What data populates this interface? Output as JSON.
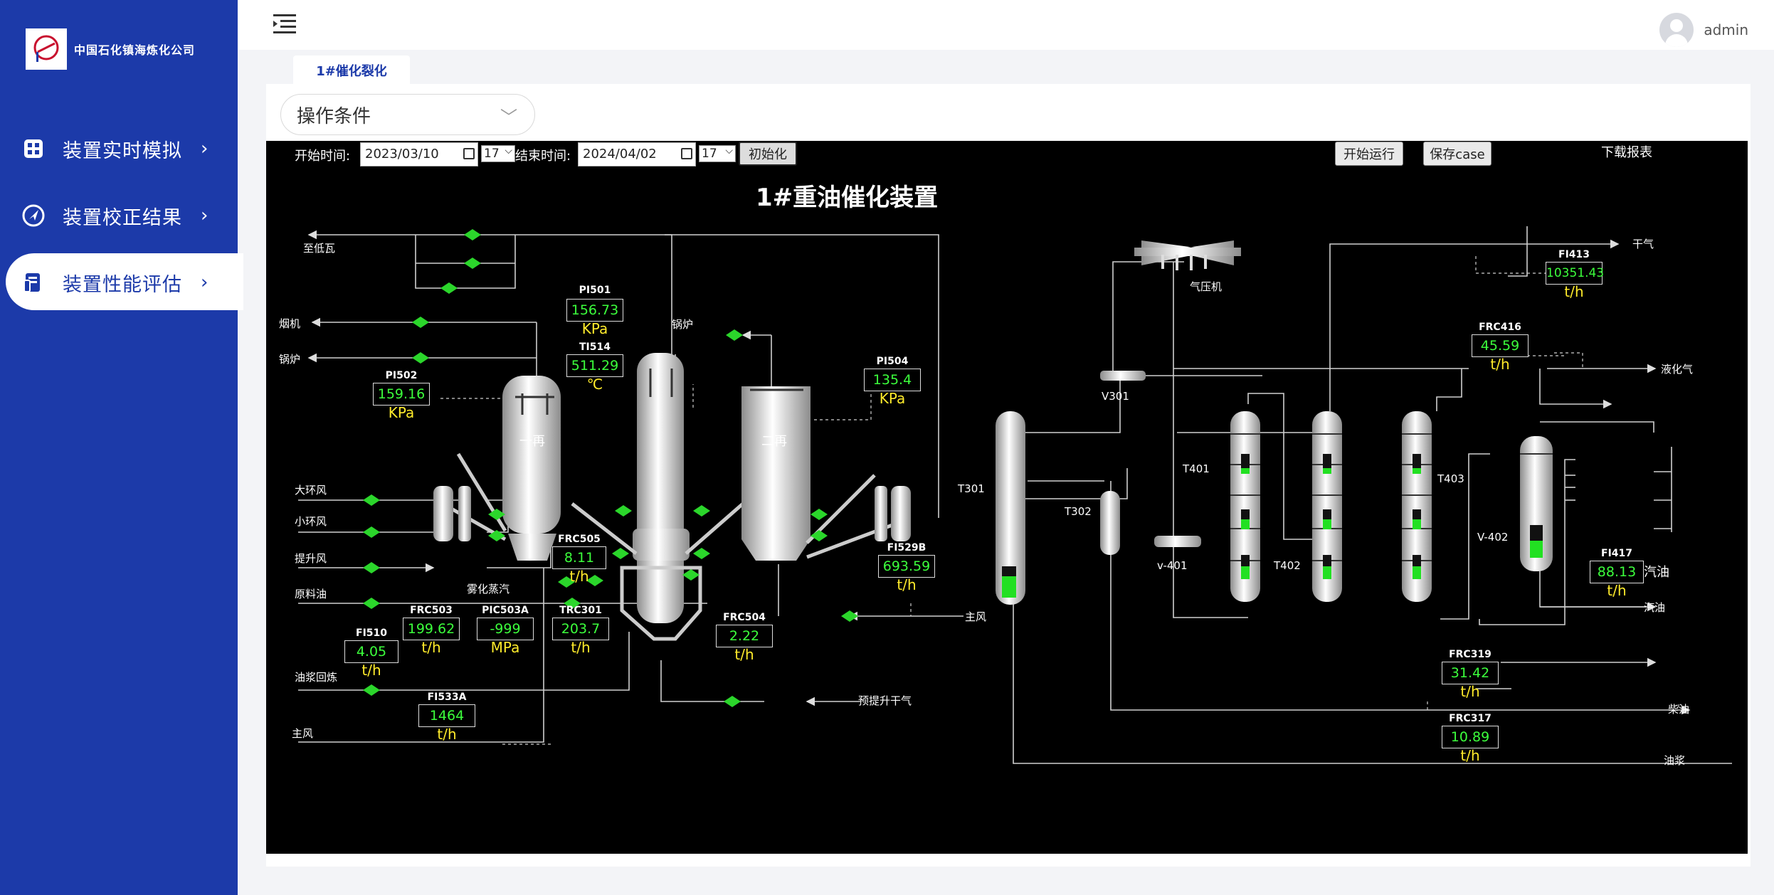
{
  "sidebar": {
    "company": "中国石化镇海炼化公司",
    "logo_text": "Sinopec",
    "items": [
      {
        "label": "装置实时模拟"
      },
      {
        "label": "装置校正结果"
      },
      {
        "label": "装置性能评估"
      }
    ]
  },
  "header": {
    "username": "admin"
  },
  "tab": {
    "label": "1#催化裂化"
  },
  "select": {
    "value": "操作条件"
  },
  "controls": {
    "start_label": "开始时间:",
    "start_date": "2023/03/10",
    "start_hour": "17",
    "end_label": "结束时间:",
    "end_date": "2024/04/02",
    "end_hour": "17",
    "init_button": "初始化",
    "run_button": "开始运行",
    "save_button": "保存case",
    "download": "下载报表"
  },
  "diagram": {
    "title": "1#重油催化装置",
    "vessels": {
      "regen1": "一再",
      "regen2": "二再",
      "t301": "T301",
      "t302": "T302",
      "v301": "V301",
      "t401": "T401",
      "t402": "T402",
      "t403": "T403",
      "v401": "v-401",
      "v402": "V-402",
      "compressor": "气压机"
    },
    "streams": {
      "zhidiwa": "至低瓦",
      "yanji": "烟机",
      "guolu_left": "锅炉",
      "guolu_top": "锅炉",
      "dahuanfeng": "大环风",
      "xiaohuanfeng": "小环风",
      "tishengfeng": "提升风",
      "yuanliaoyou": "原料油",
      "wuhuazhengqi": "雾化蒸汽",
      "youjianghuilian": "油浆回炼",
      "zhufeng_left": "主风",
      "zhufeng_mid": "主风",
      "yutishengganqi": "预提升干气",
      "ganqi": "干气",
      "yehuaqi": "液化气",
      "qiyou_1": "汽油",
      "qiyou_2": "汽油",
      "chaiyou": "柴油",
      "youjiang": "油浆"
    },
    "instruments": [
      {
        "tag": "PI501",
        "value": "156.73",
        "unit": "KPa"
      },
      {
        "tag": "TI514",
        "value": "511.29",
        "unit": "℃"
      },
      {
        "tag": "PI502",
        "value": "159.16",
        "unit": "KPa"
      },
      {
        "tag": "PI504",
        "value": "135.4",
        "unit": "KPa"
      },
      {
        "tag": "FRC505",
        "value": "8.11",
        "unit": "t/h"
      },
      {
        "tag": "FRC503",
        "value": "199.62",
        "unit": "t/h"
      },
      {
        "tag": "PIC503A",
        "value": "-999",
        "unit": "MPa"
      },
      {
        "tag": "TRC301",
        "value": "203.7",
        "unit": "t/h"
      },
      {
        "tag": "FI510",
        "value": "4.05",
        "unit": "t/h"
      },
      {
        "tag": "FI533A",
        "value": "1464",
        "unit": "t/h"
      },
      {
        "tag": "FRC504",
        "value": "2.22",
        "unit": "t/h"
      },
      {
        "tag": "FI529B",
        "value": "693.59",
        "unit": "t/h"
      },
      {
        "tag": "FI413",
        "value": "10351.43",
        "unit": "t/h"
      },
      {
        "tag": "FRC416",
        "value": "45.59",
        "unit": "t/h"
      },
      {
        "tag": "FI417",
        "value": "88.13",
        "unit": "t/h"
      },
      {
        "tag": "FRC319",
        "value": "31.42",
        "unit": "t/h"
      },
      {
        "tag": "FRC317",
        "value": "10.89",
        "unit": "t/h"
      }
    ],
    "colors": {
      "value": "#3cff3c",
      "unit": "#ffeb2b",
      "valve": "#2bd62b",
      "pipe": "#d0d0d0"
    }
  }
}
